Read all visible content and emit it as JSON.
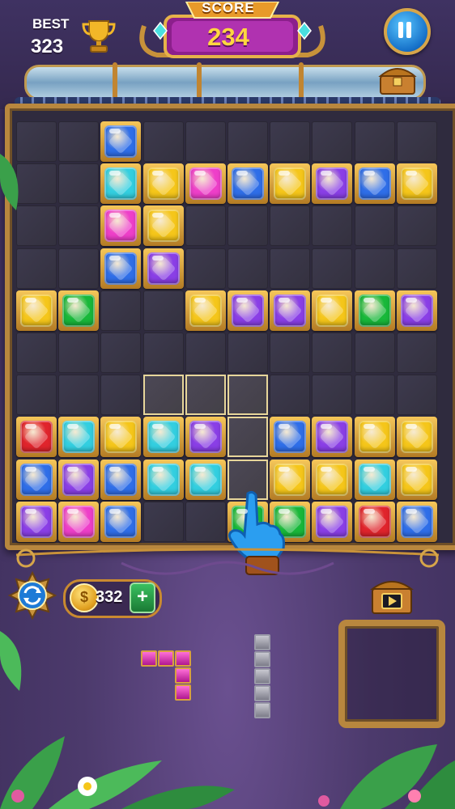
{
  "hud": {
    "best_label": "BEST",
    "best_value": "323",
    "score_label": "SCORE",
    "score_value": "234",
    "level_progress": 0.0
  },
  "coins": {
    "value": "332"
  },
  "icons": [
    "trophy-icon",
    "pause-icon",
    "treasure-chest-icon",
    "refresh-icon",
    "coin-icon",
    "plus-icon",
    "video-chest-icon",
    "pointing-hand-icon"
  ],
  "colors": {
    "blue": "#2f6ee8",
    "cyan": "#33cfe0",
    "yellow": "#f5c61a",
    "pink": "#ee3fc9",
    "purple": "#8a3fe6",
    "green": "#18b83a",
    "red": "#e0242c",
    "frame": "#b8873e",
    "accent_score": "#ffd640"
  },
  "board": {
    "size": 10,
    "rows": [
      [
        "",
        "",
        "B",
        "",
        "",
        "",
        "",
        "",
        "",
        ""
      ],
      [
        "",
        "",
        "C",
        "Y",
        "P",
        "B",
        "Y",
        "U",
        "B",
        "Y"
      ],
      [
        "",
        "",
        "P",
        "Y",
        "",
        "",
        "",
        "",
        "",
        ""
      ],
      [
        "",
        "",
        "B",
        "U",
        "",
        "",
        "",
        "",
        "",
        ""
      ],
      [
        "Y",
        "G",
        "",
        "",
        "Y",
        "U",
        "U",
        "Y",
        "G",
        "U"
      ],
      [
        "",
        "",
        "",
        "",
        "",
        "",
        "",
        "",
        "",
        ""
      ],
      [
        "",
        "",
        "",
        "",
        "",
        "",
        "",
        "",
        "",
        ""
      ],
      [
        "R",
        "C",
        "Y",
        "C",
        "U",
        "",
        "B",
        "U",
        "Y",
        "Y"
      ],
      [
        "B",
        "U",
        "B",
        "C",
        "C",
        "",
        "Y",
        "Y",
        "C",
        "Y"
      ],
      [
        "U",
        "P",
        "B",
        "",
        "",
        "G",
        "G",
        "U",
        "R",
        "B"
      ]
    ],
    "ghost_cells": [
      [
        6,
        3
      ],
      [
        6,
        4
      ],
      [
        6,
        5
      ],
      [
        7,
        5
      ],
      [
        8,
        5
      ]
    ]
  },
  "tray": {
    "piece_1": {
      "color": "pink",
      "cells": [
        [
          0,
          0
        ],
        [
          0,
          1
        ],
        [
          0,
          2
        ],
        [
          1,
          2
        ],
        [
          2,
          2
        ]
      ]
    },
    "piece_2": {
      "color": "grey",
      "cells": [
        [
          0,
          0
        ],
        [
          1,
          0
        ],
        [
          2,
          0
        ],
        [
          3,
          0
        ],
        [
          4,
          0
        ]
      ]
    },
    "hold_slot": "empty"
  }
}
